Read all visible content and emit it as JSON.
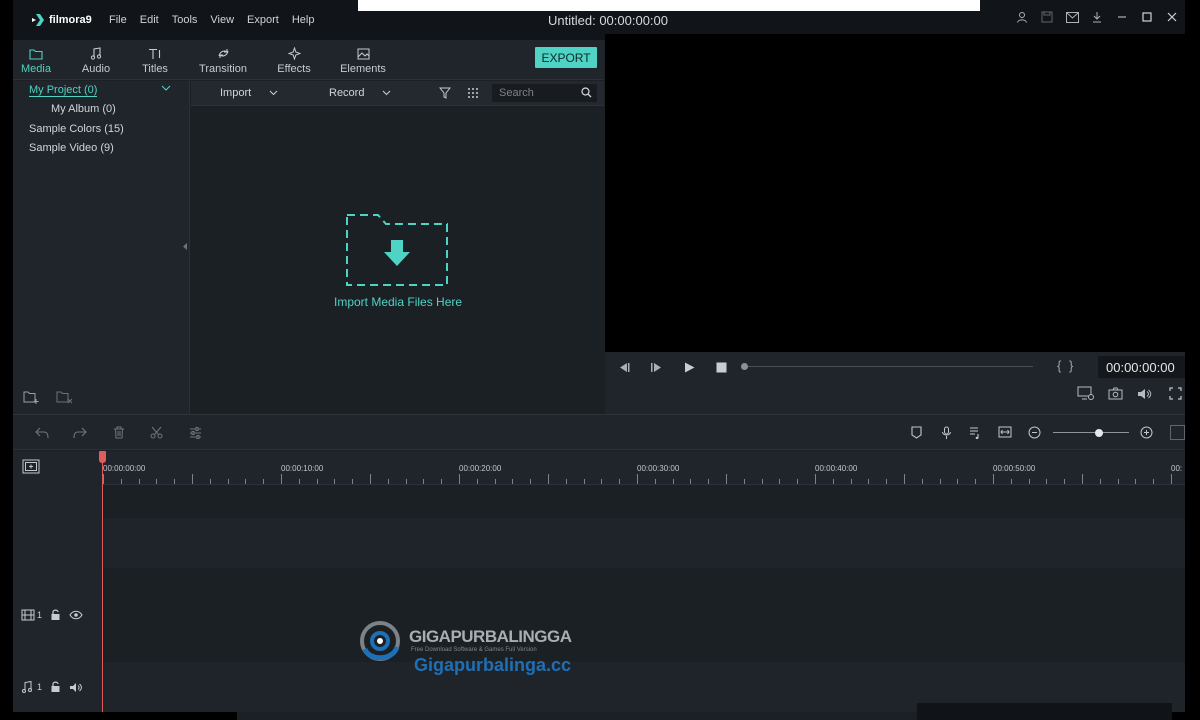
{
  "app": {
    "brand": "filmora9"
  },
  "menu": [
    "File",
    "Edit",
    "Tools",
    "View",
    "Export",
    "Help"
  ],
  "window": {
    "title": "Untitled:",
    "timecode": "00:00:00:00"
  },
  "tabs": [
    {
      "label": "Media",
      "icon": "folder-icon",
      "active": true
    },
    {
      "label": "Audio",
      "icon": "music-note-icon"
    },
    {
      "label": "Titles",
      "icon": "text-icon"
    },
    {
      "label": "Transition",
      "icon": "transition-icon"
    },
    {
      "label": "Effects",
      "icon": "sparkle-icon"
    },
    {
      "label": "Elements",
      "icon": "image-icon"
    }
  ],
  "export_label": "EXPORT",
  "library": [
    {
      "label": "My Project (0)",
      "active": true
    },
    {
      "label": "My Album (0)"
    },
    {
      "label": "Sample Colors (15)"
    },
    {
      "label": "Sample Video (9)"
    }
  ],
  "media_toolbar": {
    "import_label": "Import",
    "record_label": "Record",
    "search_placeholder": "Search"
  },
  "drop_zone": {
    "text": "Import Media Files Here"
  },
  "preview": {
    "timecode": "00:00:00:00",
    "brackets": "{ }"
  },
  "timeline": {
    "ruler_labels": [
      "00:00:00:00",
      "00:00:10:00",
      "00:00:20:00",
      "00:00:30:00",
      "00:00:40:00",
      "00:00:50:00",
      "00:"
    ],
    "video_track": "1",
    "audio_track": "1"
  },
  "watermark": {
    "title": "GIGAPURBALINGGA",
    "subtitle": "Free Download Software & Games Full Version",
    "url": "Gigapurbalinga.cc"
  },
  "colors": {
    "accent": "#4fd3c4",
    "playhead": "#e25c5c",
    "bg": "#1b2025"
  }
}
